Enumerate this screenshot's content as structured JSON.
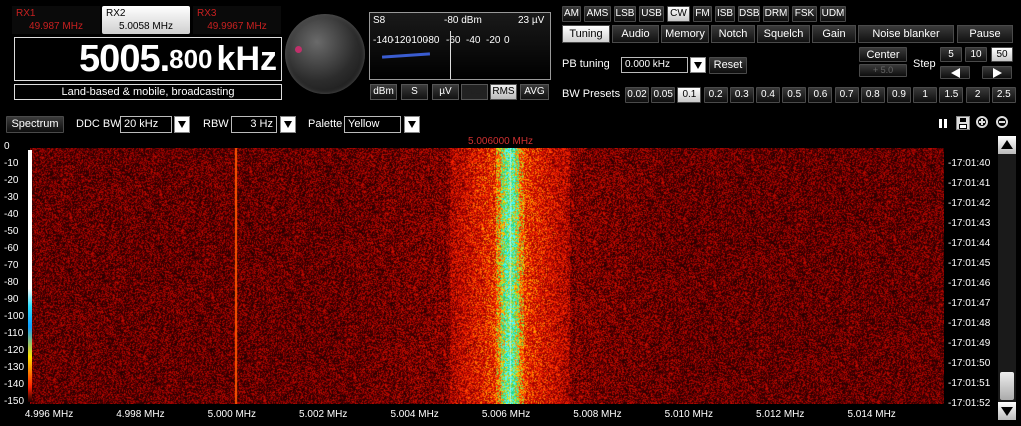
{
  "rx_tabs": [
    {
      "name": "RX1",
      "freq": "49.987 MHz"
    },
    {
      "name": "RX2",
      "freq": "5.0058 MHz"
    },
    {
      "name": "RX3",
      "freq": "49.9967 MHz"
    }
  ],
  "frequency": {
    "main": "5005.",
    "fraction": "800",
    "unit": "kHz"
  },
  "band_label": "Land-based & mobile, broadcasting",
  "meter": {
    "s_label": "S8",
    "dbm_label": "-80 dBm",
    "uv_label": "23 µV",
    "scale": [
      "-140",
      "-120",
      "-100",
      "-80",
      "-60",
      "-40",
      "-20",
      "0"
    ],
    "level_dbm": -120,
    "buttons": [
      {
        "label": "dBm",
        "selected": true
      },
      {
        "label": "S",
        "selected": false
      },
      {
        "label": "µV",
        "selected": false
      },
      {
        "label": "Peak",
        "selected": false,
        "disabled": true
      },
      {
        "label": "RMS",
        "selected": true
      },
      {
        "label": "AVG",
        "selected": false
      }
    ]
  },
  "modes": [
    {
      "label": "AM",
      "selected": false
    },
    {
      "label": "AMS",
      "selected": false
    },
    {
      "label": "LSB",
      "selected": false
    },
    {
      "label": "USB",
      "selected": false
    },
    {
      "label": "CW",
      "selected": true
    },
    {
      "label": "FM",
      "selected": false
    },
    {
      "label": "ISB",
      "selected": false
    },
    {
      "label": "DSB",
      "selected": false
    },
    {
      "label": "DRM",
      "selected": false
    },
    {
      "label": "FSK",
      "selected": false
    },
    {
      "label": "UDM",
      "selected": false
    }
  ],
  "tabs": [
    {
      "label": "Tuning",
      "selected": true
    },
    {
      "label": "Audio",
      "selected": false
    },
    {
      "label": "Memory",
      "selected": false
    },
    {
      "label": "Notch",
      "selected": false
    },
    {
      "label": "Squelch",
      "selected": false
    },
    {
      "label": "Gain",
      "selected": false
    },
    {
      "label": "Noise blanker",
      "selected": false
    },
    {
      "label": "Pause",
      "selected": false
    }
  ],
  "tuning": {
    "pb_label": "PB tuning",
    "pb_value": "0.000 kHz",
    "reset_label": "Reset",
    "center_label": "Center",
    "center_sub": "+ 5.0",
    "step_label": "Step",
    "steps": [
      {
        "label": "5",
        "selected": false
      },
      {
        "label": "10",
        "selected": false
      },
      {
        "label": "50",
        "selected": true
      }
    ],
    "bw_label": "BW Presets",
    "bw_presets": [
      {
        "label": "0.02",
        "selected": false
      },
      {
        "label": "0.05",
        "selected": false
      },
      {
        "label": "0.1",
        "selected": true
      },
      {
        "label": "0.2",
        "selected": false
      },
      {
        "label": "0.3",
        "selected": false
      },
      {
        "label": "0.4",
        "selected": false
      },
      {
        "label": "0.5",
        "selected": false
      },
      {
        "label": "0.6",
        "selected": false
      },
      {
        "label": "0.7",
        "selected": false
      },
      {
        "label": "0.8",
        "selected": false
      },
      {
        "label": "0.9",
        "selected": false
      },
      {
        "label": "1",
        "selected": false
      },
      {
        "label": "1.5",
        "selected": false
      },
      {
        "label": "2",
        "selected": false
      },
      {
        "label": "2.5",
        "selected": false
      }
    ]
  },
  "toolbar": {
    "spectrum_label": "Spectrum",
    "ddc_label": "DDC BW",
    "ddc_value": "20 kHz",
    "rbw_label": "RBW",
    "rbw_value": "3 Hz",
    "palette_label": "Palette",
    "palette_value": "Yellow"
  },
  "waterfall": {
    "marker_freq": "5.006000 MHz",
    "db_ticks": [
      "0",
      "-10",
      "-20",
      "-30",
      "-40",
      "-50",
      "-60",
      "-70",
      "-80",
      "-90",
      "-100",
      "-110",
      "-120",
      "-130",
      "-140",
      "-150"
    ],
    "time_ticks": [
      "-17:01:40",
      "-17:01:41",
      "-17:01:42",
      "-17:01:43",
      "-17:01:44",
      "-17:01:45",
      "-17:01:46",
      "-17:01:47",
      "-17:01:48",
      "-17:01:49",
      "-17:01:50",
      "-17:01:51",
      "-17:01:52"
    ],
    "freq_ticks": [
      "4.996 MHz",
      "4.998 MHz",
      "5.000 MHz",
      "5.002 MHz",
      "5.004 MHz",
      "5.006 MHz",
      "5.008 MHz",
      "5.010 MHz",
      "5.012 MHz",
      "5.014 MHz"
    ],
    "freq_range_mhz": [
      4.9955,
      5.0155
    ],
    "signal_center_mhz": 5.006,
    "carrier_mhz": 5.0
  }
}
